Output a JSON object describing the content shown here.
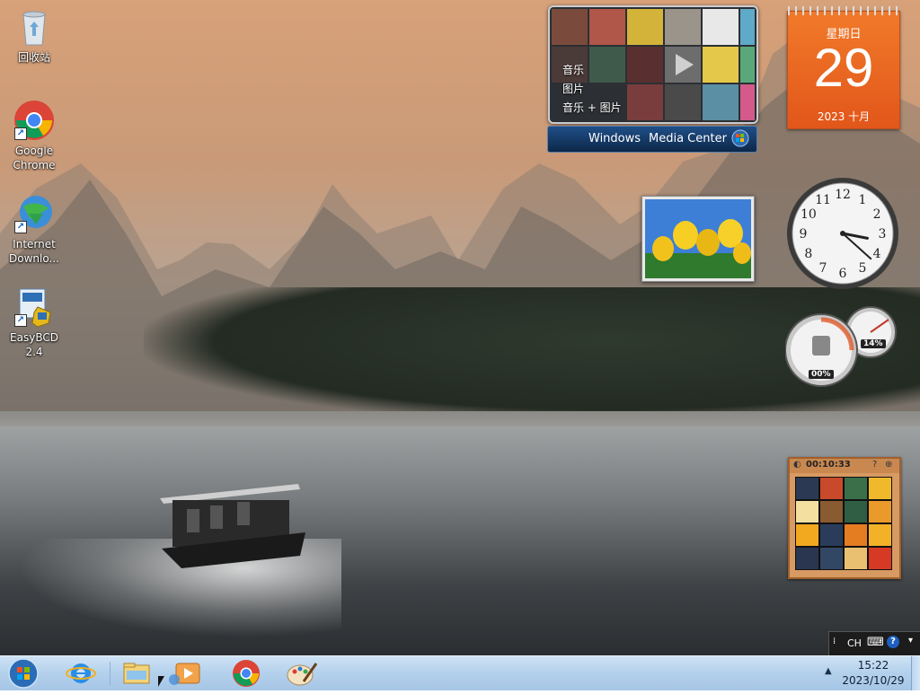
{
  "desktop_icons": [
    {
      "label": "回收站",
      "icon": "recycle-bin-icon"
    },
    {
      "label": "Google\nChrome",
      "icon": "chrome-icon"
    },
    {
      "label": "Internet\nDownlo...",
      "icon": "internet-download-manager-icon"
    },
    {
      "label": "EasyBCD 2.4",
      "icon": "easybcd-icon"
    }
  ],
  "media_center": {
    "items": [
      "音乐",
      "图片",
      "音乐 + 图片"
    ],
    "bar_brand": "Windows",
    "bar_product": "Media Center"
  },
  "calendar": {
    "weekday": "星期日",
    "day": "29",
    "month": "2023 十月"
  },
  "clock": {
    "time_shown": "15:22",
    "numerals": [
      "12",
      "1",
      "2",
      "3",
      "4",
      "5",
      "6",
      "7",
      "8",
      "9",
      "10",
      "11"
    ]
  },
  "meters": {
    "cpu_percent": "00%",
    "memory_percent": "14%"
  },
  "puzzle": {
    "timer": "00:10:33"
  },
  "language_bar": {
    "lang": "CH"
  },
  "taskbar": {
    "pinned": [
      "start-orb",
      "internet-explorer-icon",
      "windows-explorer-icon",
      "media-player-icon",
      "chrome-icon",
      "paint-icon"
    ],
    "time": "15:22",
    "date": "2023/10/29"
  },
  "colors": {
    "calendar_orange": "#e9641f",
    "taskbar_blue": "#b5d1ec",
    "wmc_bar": "#143a66"
  }
}
